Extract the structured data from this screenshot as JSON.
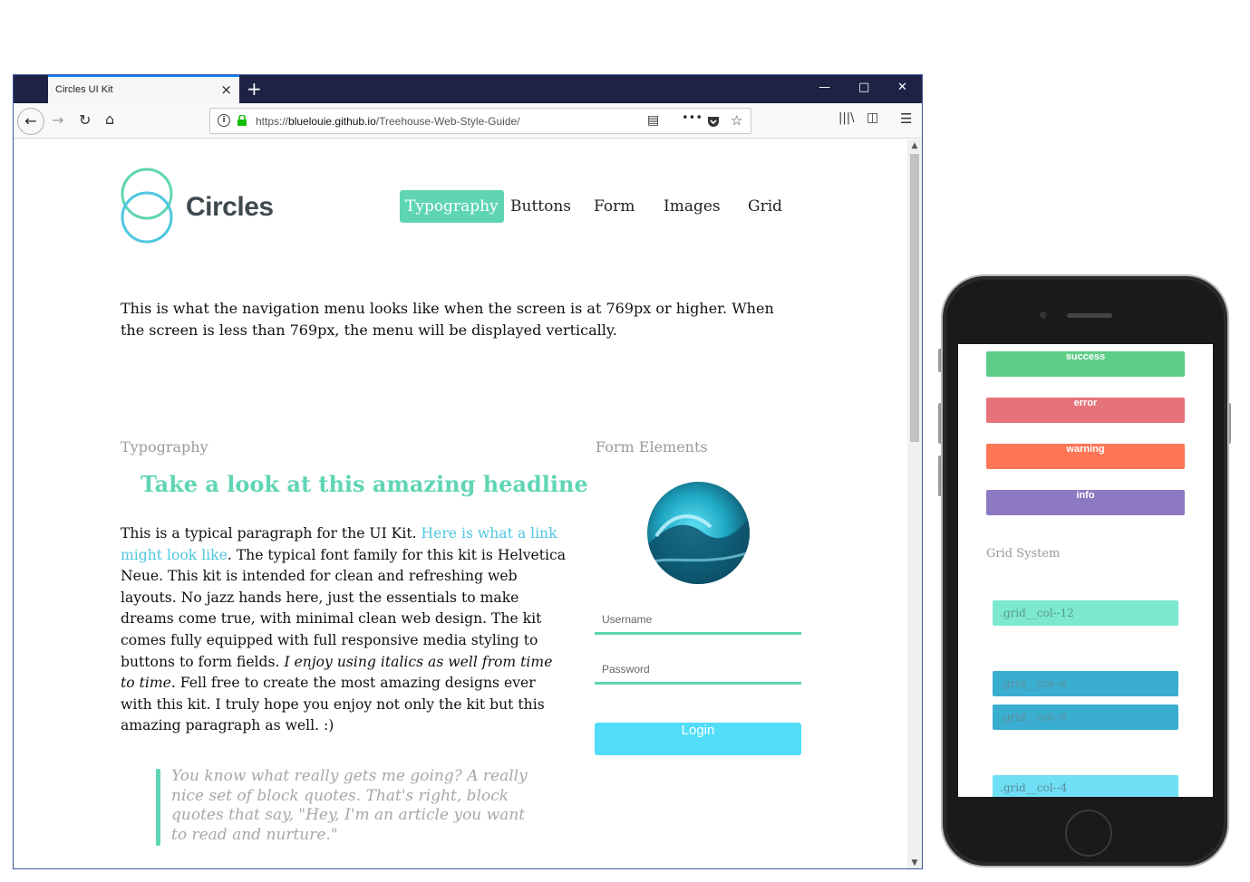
{
  "browser": {
    "tab_title": "Circles UI Kit",
    "tab_close": "×",
    "new_tab": "+",
    "minimize": "—",
    "maximize": "□",
    "close": "✕",
    "url_prefix": "https://",
    "url_domain": "bluelouie.github.io",
    "url_path": "/Treehouse-Web-Style-Guide/",
    "page_actions": "•••"
  },
  "site": {
    "logo_text": "Circles",
    "nav": [
      {
        "label": "Typography",
        "active": true
      },
      {
        "label": "Buttons",
        "active": false
      },
      {
        "label": "Form",
        "active": false
      },
      {
        "label": "Images",
        "active": false
      },
      {
        "label": "Grid",
        "active": false
      }
    ],
    "intro": "This is what the navigation menu looks like when the screen is at 769px or higher. When the screen is less than 769px, the menu will be displayed vertically.",
    "typography": {
      "label": "Typography",
      "headline": "Take a look at this amazing headline",
      "para_start": "This is a typical paragraph for the UI Kit. ",
      "para_link": "Here is what a link might look like",
      "para_middle": ". The typical font family for this kit is Helvetica Neue. This kit is intended for clean and refreshing web layouts. No jazz hands here, just the essentials to make dreams come true, with minimal clean web design. The kit comes fully equipped with full responsive media styling to buttons to form fields. ",
      "para_italic": "I enjoy using italics as well from time to time",
      "para_end": ". Fell free to create the most amazing designs ever with this kit. I truly hope you enjoy not only the kit but this amazing paragraph as well. :)",
      "blockquote": "You know what really gets me going? A really nice set of block quotes. That's right, block quotes that say, \"Hey, I'm an article you want to read and nurture.\""
    },
    "form": {
      "label": "Form Elements",
      "username_label": "Username",
      "password_label": "Password",
      "login_label": "Login"
    }
  },
  "phone": {
    "alerts": [
      {
        "label": "success",
        "color": "#5dcd88"
      },
      {
        "label": "error",
        "color": "#e6727a"
      },
      {
        "label": "warning",
        "color": "#fd7656"
      },
      {
        "label": "info",
        "color": "#8d79c2"
      }
    ],
    "grid_label": "Grid System",
    "grid_cols": [
      {
        "label": ".grid__col--12",
        "color": "#7ce8cf"
      },
      {
        "label": ".grid__col--6",
        "color": "#3aaed0"
      },
      {
        "label": ".grid__col--6",
        "color": "#3aaed0"
      },
      {
        "label": ".grid__col--4",
        "color": "#6fdff5"
      }
    ]
  },
  "colors": {
    "accent": "#5fd5b4",
    "link": "#4ec7e0",
    "button": "#51ddf8",
    "titlebar": "#1e2346"
  }
}
